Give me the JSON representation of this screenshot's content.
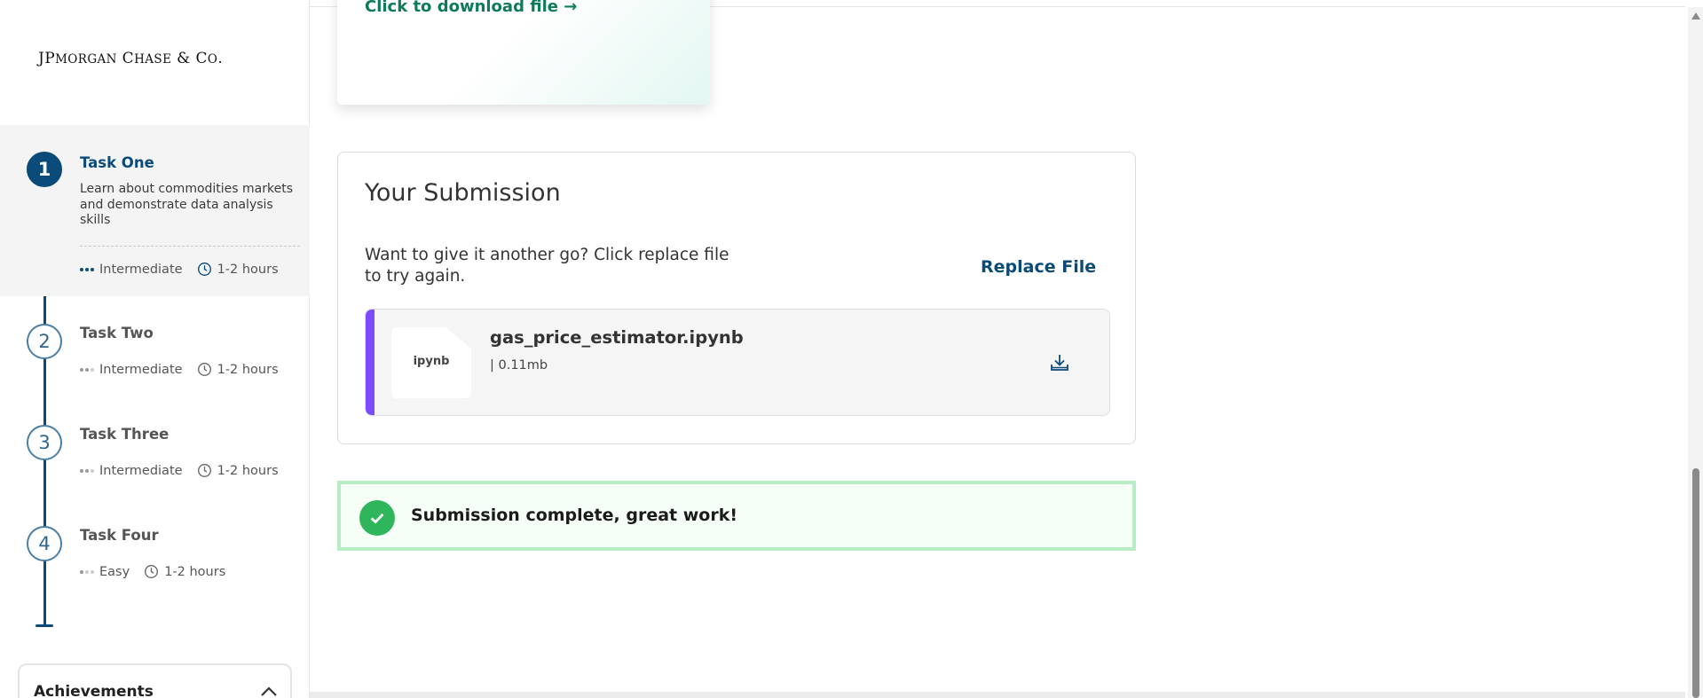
{
  "sidebar": {
    "logo": "JPMorgan Chase & Co.",
    "tasks": [
      {
        "number": "1",
        "title": "Task One",
        "description": "Learn about commodities markets and demonstrate data analysis skills",
        "level": "Intermediate",
        "duration": "1-2 hours"
      },
      {
        "number": "2",
        "title": "Task Two",
        "level": "Intermediate",
        "duration": "1-2 hours"
      },
      {
        "number": "3",
        "title": "Task Three",
        "level": "Intermediate",
        "duration": "1-2 hours"
      },
      {
        "number": "4",
        "title": "Task Four",
        "level": "Easy",
        "duration": "1-2 hours"
      }
    ],
    "achievements_label": "Achievements"
  },
  "main": {
    "download_link": "Click to download file →",
    "submission": {
      "title": "Your Submission",
      "prompt": "Want to give it another go? Click replace file to try again.",
      "replace_label": "Replace File",
      "file": {
        "extension": "ipynb",
        "name": "gas_price_estimator.ipynb",
        "size": "| 0.11mb"
      }
    },
    "success_message": "Submission complete, great work!"
  },
  "colors": {
    "brand_blue": "#0a4b7a",
    "accent_purple": "#7b4dff",
    "success_green": "#2fb55b",
    "link_green": "#0d7a5a"
  },
  "icons": {
    "clock": "clock-icon",
    "download": "download-icon",
    "check": "check-icon",
    "chevron": "chevron-up-icon"
  }
}
